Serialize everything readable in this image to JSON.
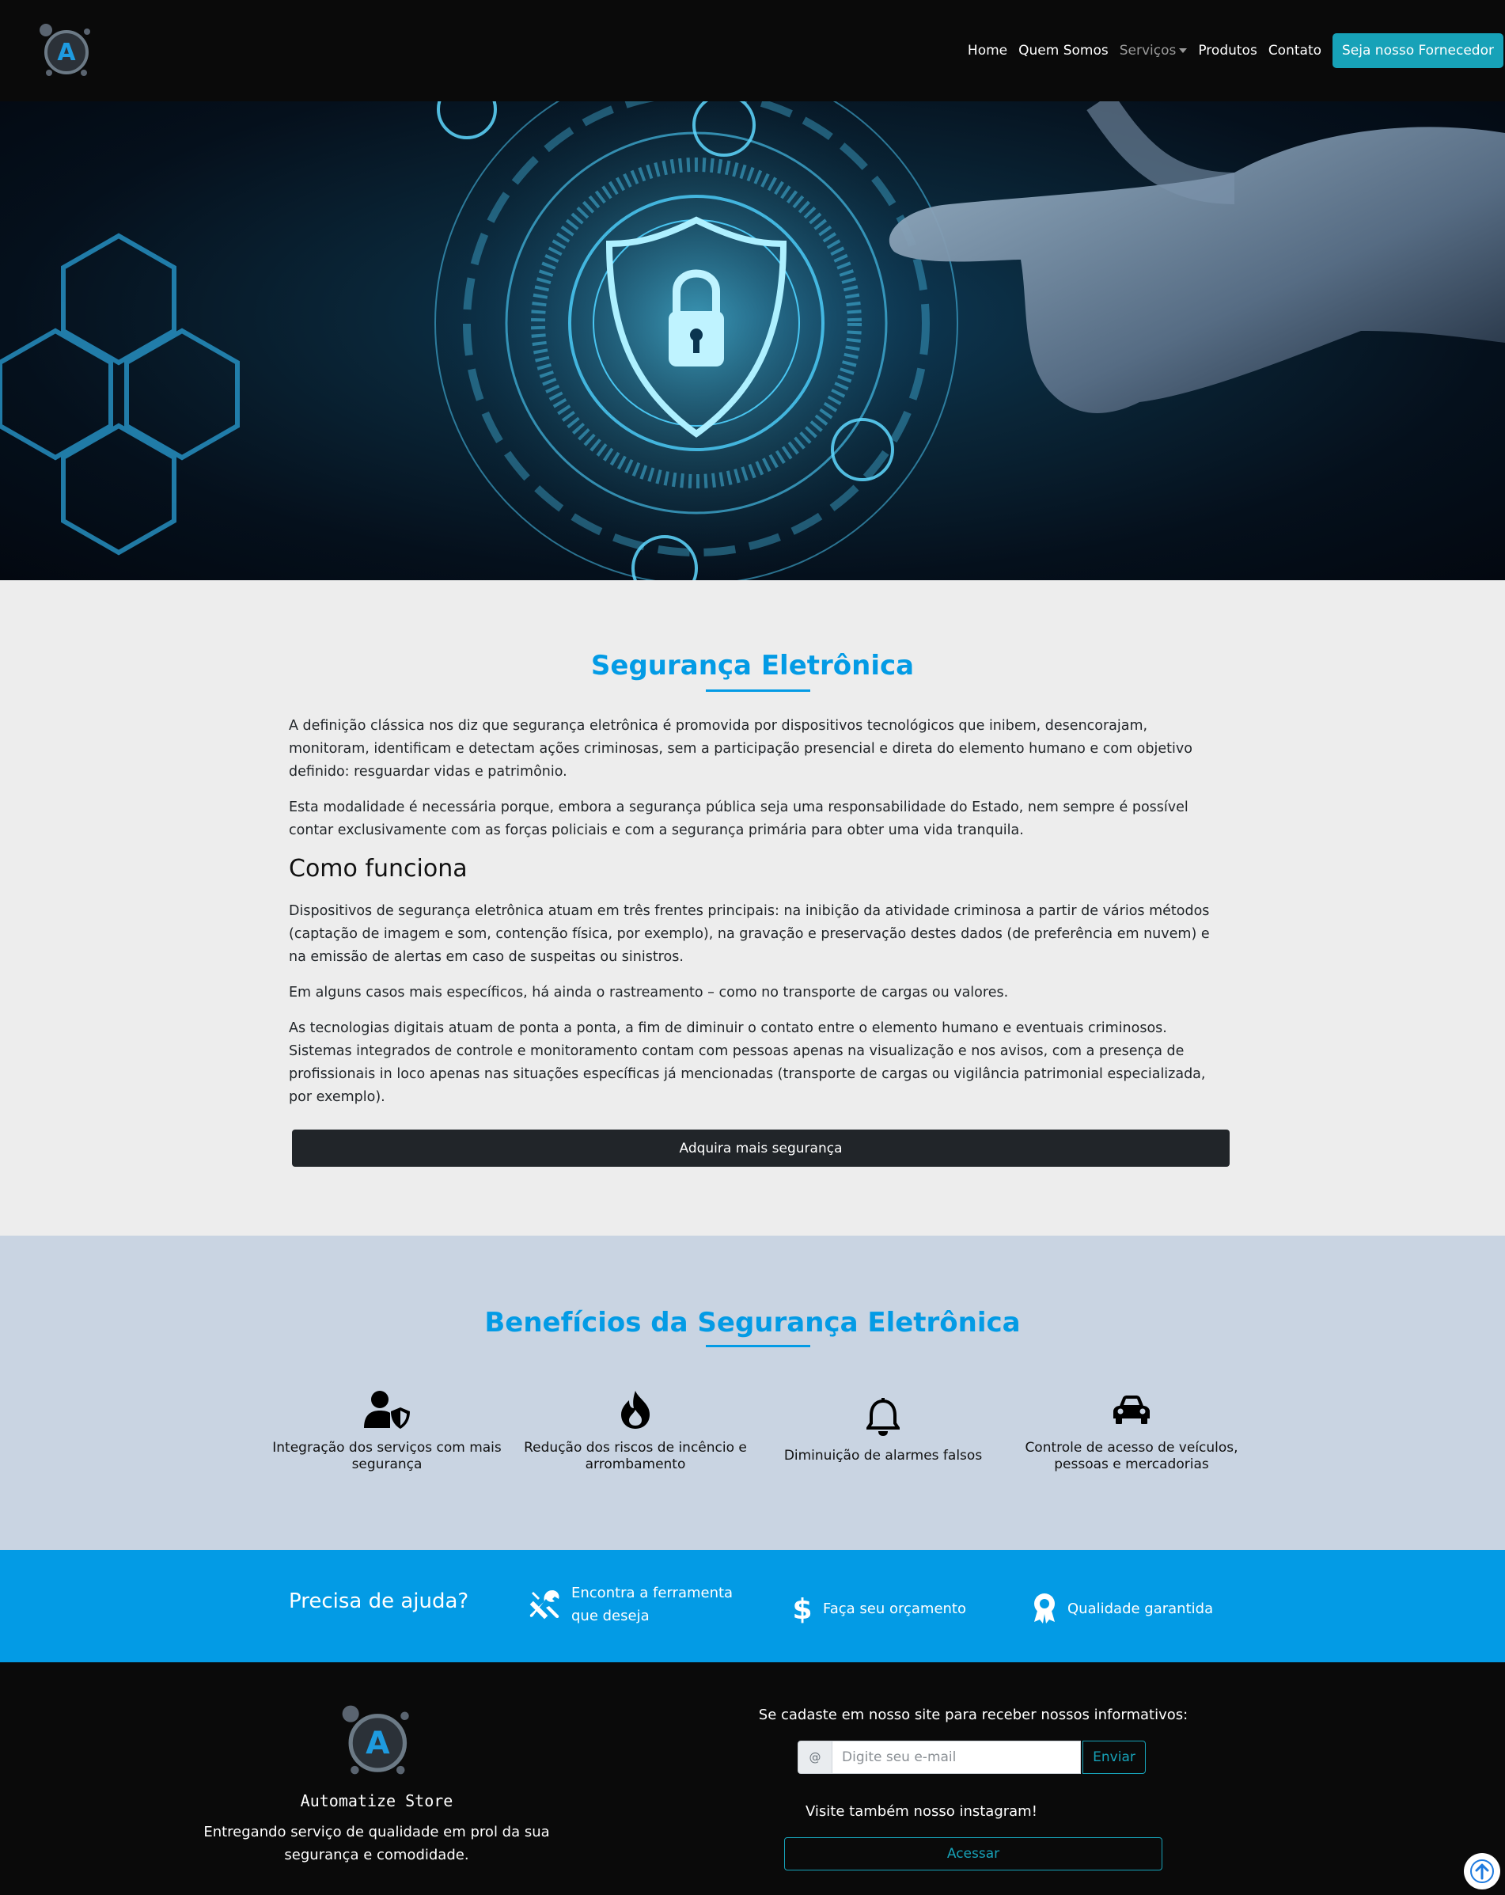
{
  "nav": {
    "logo_letter": "A",
    "links": [
      "Home",
      "Quem Somos",
      "Serviços",
      "Produtos",
      "Contato"
    ],
    "cta": "Seja nosso Fornecedor"
  },
  "main": {
    "title": "Segurança Eletrônica",
    "paragraphs": [
      "A definição clássica nos diz que segurança eletrônica é promovida por dispositivos tecnológicos que inibem, desencorajam, monitoram, identificam e detectam ações criminosas, sem a participação presencial e direta do elemento humano e com objetivo definido: resguardar vidas e patrimônio.",
      "Esta modalidade é necessária porque, embora a segurança pública seja uma responsabilidade do Estado, nem sempre é possível contar exclusivamente com as forças policiais e com a segurança primária para obter uma vida tranquila."
    ],
    "subheading": "Como funciona",
    "paragraphs2": [
      "Dispositivos de segurança eletrônica atuam em três frentes principais: na inibição da atividade criminosa a partir de vários métodos (captação de imagem e som, contenção física, por exemplo), na gravação e preservação destes dados (de preferência em nuvem) e na emissão de alertas em caso de suspeitas ou sinistros.",
      "Em alguns casos mais específicos, há ainda o rastreamento – como no transporte de cargas ou valores.",
      "As tecnologias digitais atuam de ponta a ponta, a fim de diminuir o contato entre o elemento humano e eventuais criminosos. Sistemas integrados de controle e monitoramento contam com pessoas apenas na visualização e nos avisos, com a presença de profissionais in loco apenas nas situações específicas já mencionadas (transporte de cargas ou vigilância patrimonial especializada, por exemplo)."
    ],
    "cta": "Adquira mais segurança"
  },
  "benefits": {
    "title": "Benefícios da Segurança Eletrônica",
    "items": [
      {
        "icon": "user-shield-icon",
        "label": "Integração dos serviços com mais segurança"
      },
      {
        "icon": "fire-icon",
        "label": "Redução dos riscos de incêncio e arrombamento"
      },
      {
        "icon": "bell-icon",
        "label": "Diminuição de alarmes falsos"
      },
      {
        "icon": "car-icon",
        "label": "Controle de acesso de veículos, pessoas e mercadorias"
      }
    ]
  },
  "help": {
    "title": "Precisa de ajuda?",
    "items": [
      {
        "icon": "tools-icon",
        "label_line1": "Encontra a ferramenta",
        "label_line2": "que deseja"
      },
      {
        "icon": "dollar-icon",
        "label": "Faça seu orçamento"
      },
      {
        "icon": "award-icon",
        "label": "Qualidade garantida"
      }
    ]
  },
  "footer": {
    "store_name": "Automatize Store",
    "tagline_line1": "Entregando serviço de qualidade em prol da sua",
    "tagline_line2": "segurança e comodidade.",
    "newsletter_text": "Se cadaste em nosso site para receber nossos informativos:",
    "at_symbol": "@",
    "email_placeholder": "Digite seu e-mail",
    "send_label": "Enviar",
    "instagram_text": "Visite também nosso instagram!",
    "access_label": "Acessar"
  },
  "colors": {
    "accent": "#039be5",
    "teal": "#17a2b8",
    "dark": "#0a0a0a",
    "benefits_bg": "#c9d4e2"
  }
}
